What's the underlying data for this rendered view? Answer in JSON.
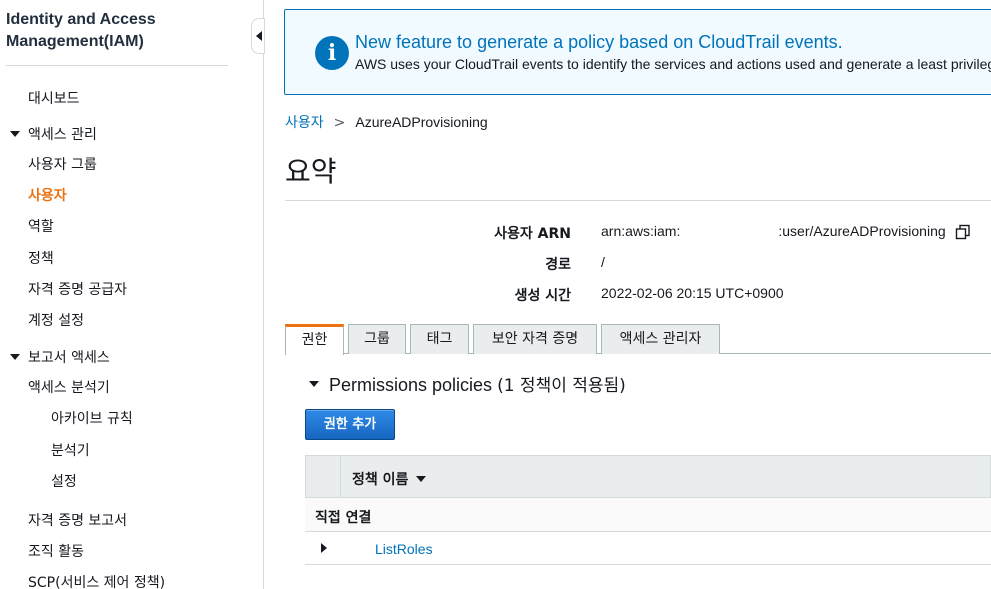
{
  "sidebar": {
    "title": "Identity and Access Management(IAM)",
    "items": [
      {
        "label": "대시보드"
      },
      {
        "label": "액세스 관리"
      },
      {
        "label": "사용자 그룹"
      },
      {
        "label": "사용자"
      },
      {
        "label": "역할"
      },
      {
        "label": "정책"
      },
      {
        "label": "자격 증명 공급자"
      },
      {
        "label": "계정 설정"
      },
      {
        "label": "보고서 액세스"
      },
      {
        "label": "액세스 분석기"
      },
      {
        "label": "아카이브 규칙"
      },
      {
        "label": "분석기"
      },
      {
        "label": "설정"
      },
      {
        "label": "자격 증명 보고서"
      },
      {
        "label": "조직 활동"
      },
      {
        "label": "SCP(서비스 제어 정책)"
      }
    ],
    "active_item": "사용자"
  },
  "banner": {
    "icon": "info-icon",
    "icon_glyph": "i",
    "title": "New feature to generate a policy based on CloudTrail events.",
    "text": "AWS uses your CloudTrail events to identify the services and actions used and generate a least privileg"
  },
  "breadcrumb": {
    "parent": "사용자",
    "separator": ">",
    "current": "AzureADProvisioning"
  },
  "page": {
    "title": "요약"
  },
  "summary": {
    "arn_label": "사용자 ARN",
    "arn_value_prefix": "arn:aws:iam:",
    "arn_value_suffix": ":user/AzureADProvisioning",
    "path_label": "경로",
    "path_value": "/",
    "created_label": "생성 시간",
    "created_value": "2022-02-06 20:15 UTC+0900"
  },
  "tabs": [
    {
      "label": "권한",
      "active": true
    },
    {
      "label": "그룹",
      "active": false
    },
    {
      "label": "태그",
      "active": false
    },
    {
      "label": "보안 자격 증명",
      "active": false
    },
    {
      "label": "액세스 관리자",
      "active": false
    }
  ],
  "permissions": {
    "header_en": "Permissions policies",
    "header_count": "(1 정책이 적용됨)",
    "add_button": "권한 추가",
    "column_policy_name": "정책 이름",
    "group_label": "직접 연결",
    "policies": [
      {
        "name": "ListRoles"
      }
    ]
  },
  "colors": {
    "accent": "#ec7211",
    "link": "#0073bb",
    "banner_bg": "#f1faff",
    "primary_button": "#1f7ad6"
  }
}
